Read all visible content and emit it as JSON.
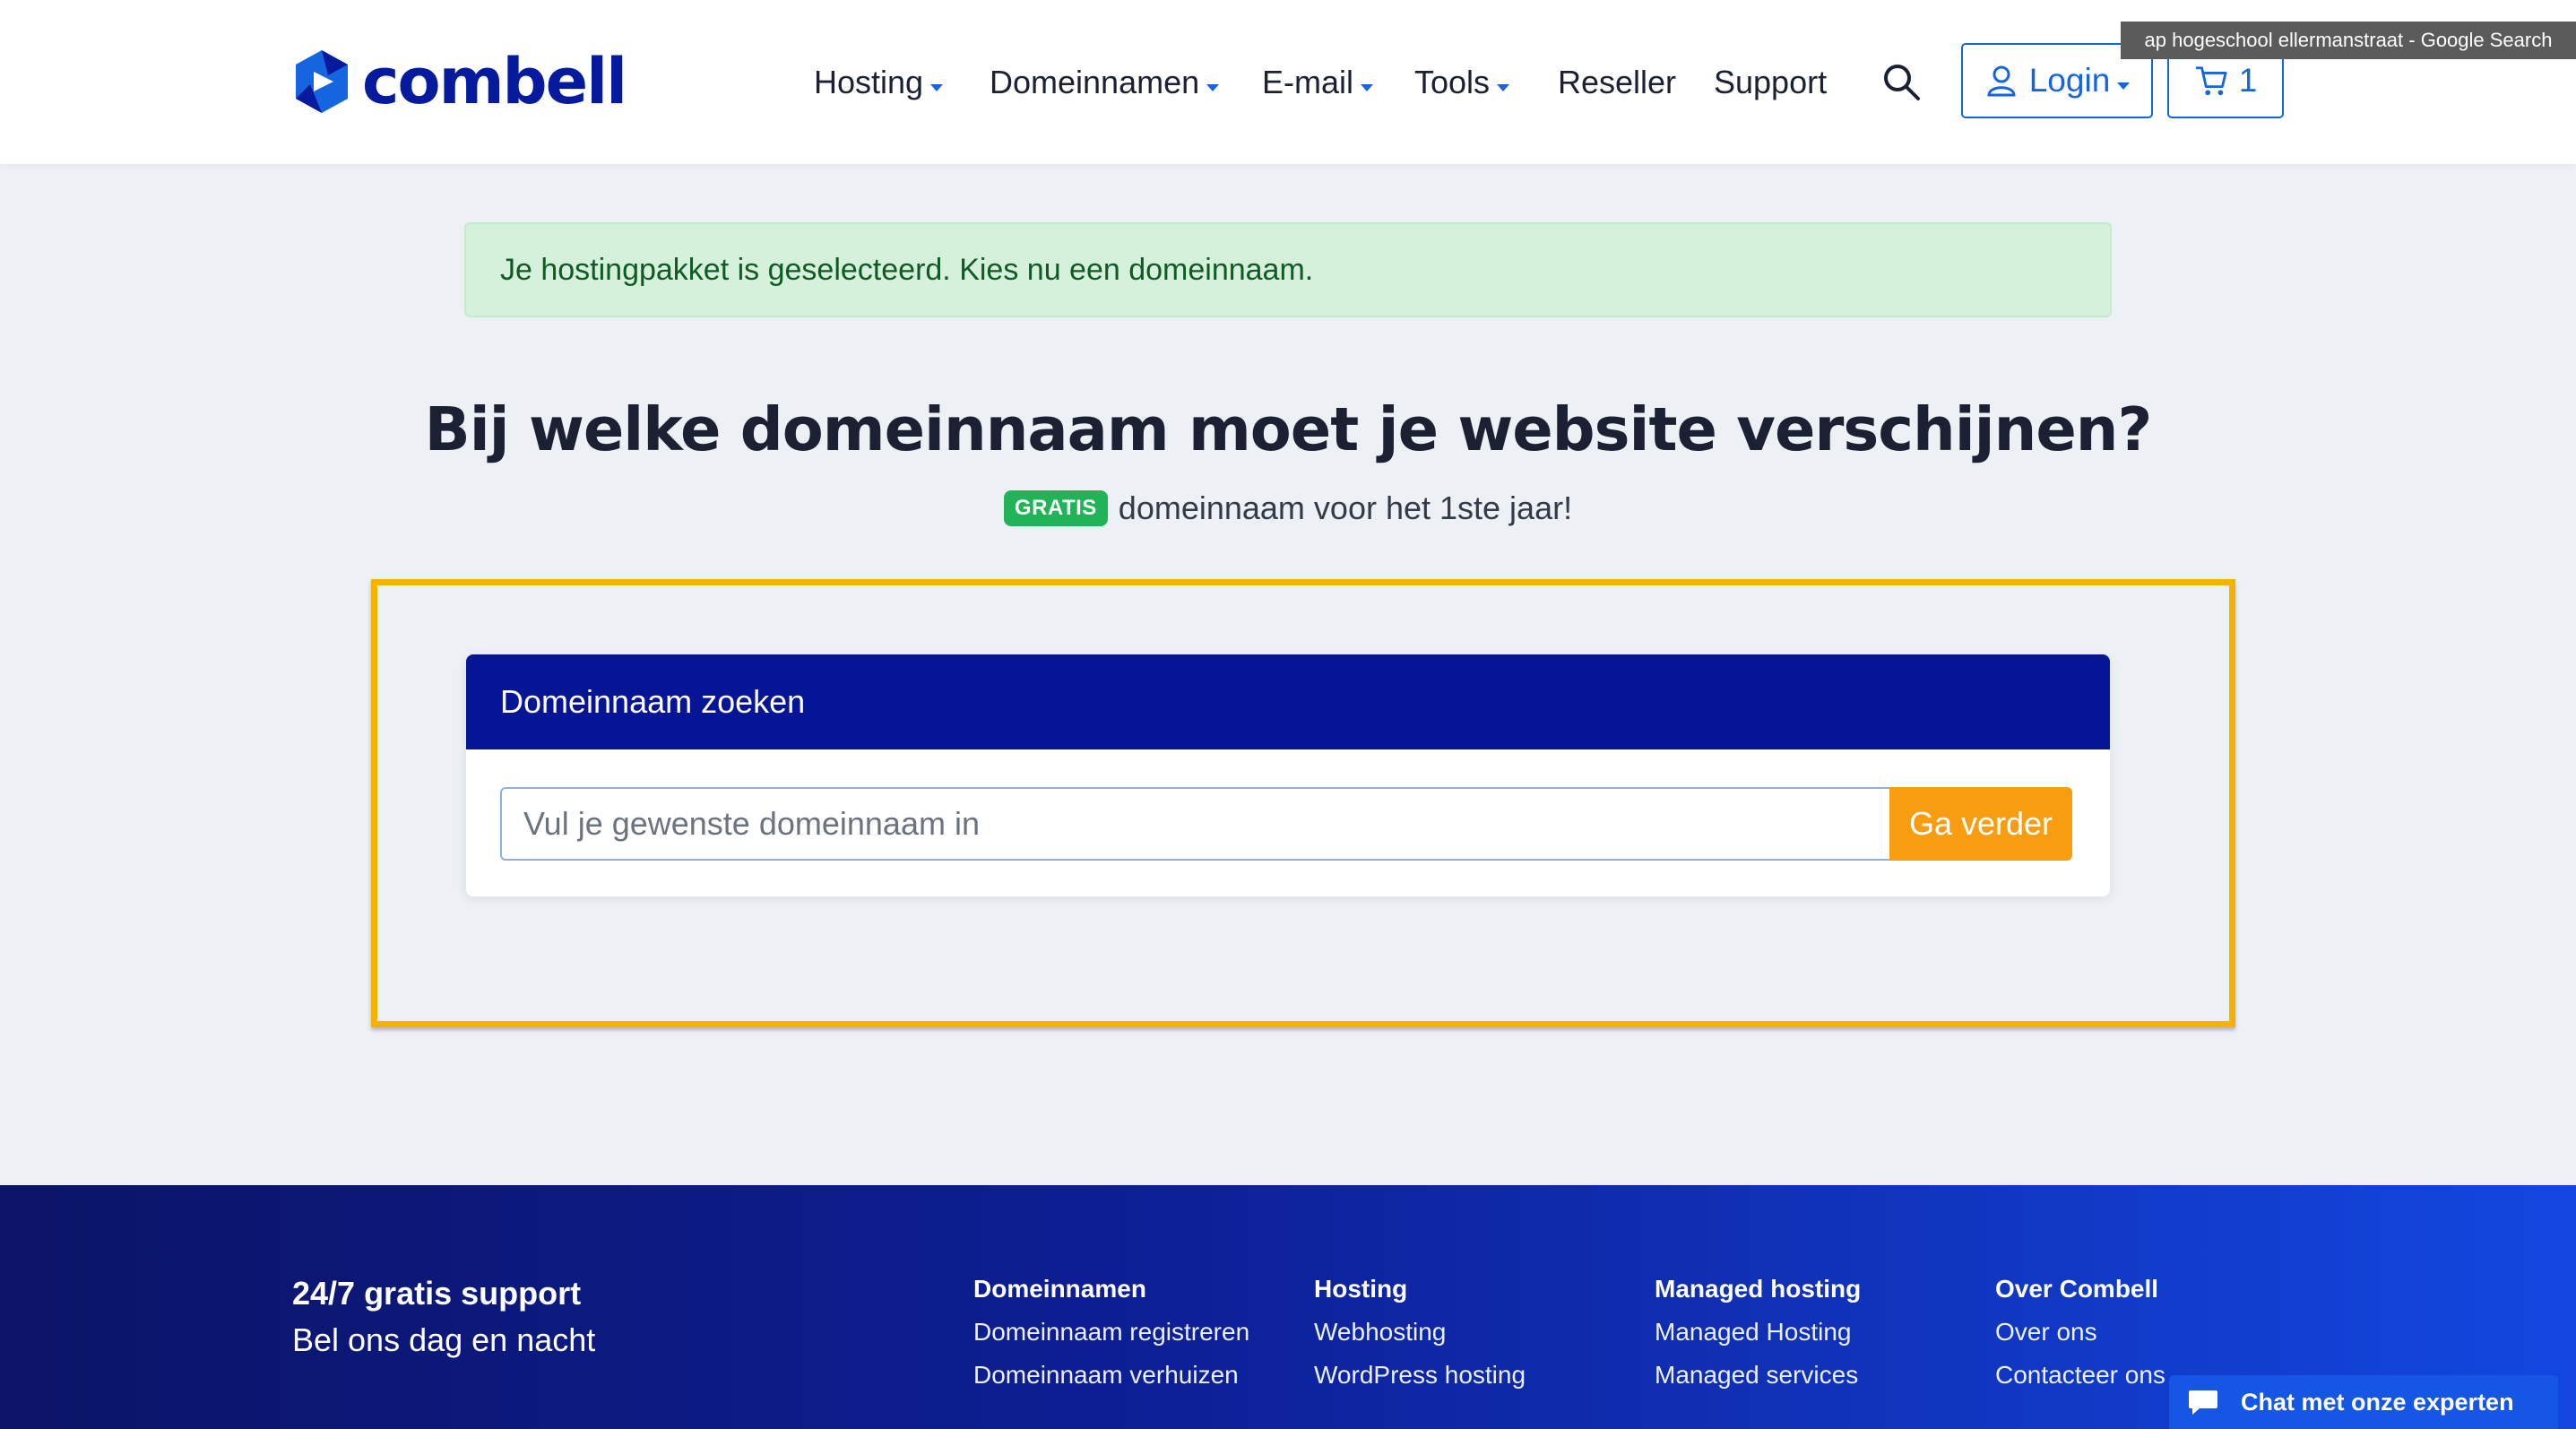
{
  "header": {
    "brand": "combell",
    "nav": [
      {
        "label": "Hosting",
        "dropdown": true
      },
      {
        "label": "Domeinnamen",
        "dropdown": true
      },
      {
        "label": "E-mail",
        "dropdown": true
      },
      {
        "label": "Tools",
        "dropdown": true
      },
      {
        "label": "Reseller",
        "dropdown": false
      },
      {
        "label": "Support",
        "dropdown": false
      }
    ],
    "login_label": "Login",
    "cart_count": "1",
    "tooltip": "ap hogeschool ellermanstraat - Google Search"
  },
  "alert": {
    "text": "Je hostingpakket is geselecteerd. Kies nu een domeinnaam."
  },
  "hero": {
    "title": "Bij welke domeinnaam moet je website verschijnen?",
    "badge": "GRATIS",
    "subtitle": "domeinnaam voor het 1ste jaar!"
  },
  "search": {
    "heading": "Domeinnaam zoeken",
    "placeholder": "Vul je gewenste domeinnaam in",
    "button": "Ga verder"
  },
  "footer": {
    "support_title": "24/7 gratis support",
    "support_sub": "Bel ons dag en nacht",
    "columns": [
      {
        "title": "Domeinnamen",
        "links": [
          "Domeinnaam registreren",
          "Domeinnaam verhuizen"
        ]
      },
      {
        "title": "Hosting",
        "links": [
          "Webhosting",
          "WordPress hosting"
        ]
      },
      {
        "title": "Managed hosting",
        "links": [
          "Managed Hosting",
          "Managed services"
        ]
      },
      {
        "title": "Over Combell",
        "links": [
          "Over ons",
          "Contacteer ons"
        ]
      }
    ],
    "chat": "Chat met onze experten"
  },
  "colors": {
    "brand": "#061a9e",
    "link": "#1565e0",
    "cta": "#f99d10",
    "highlight": "#f5b300",
    "success_bg": "#d5f0db",
    "badge": "#21b357"
  },
  "icons": [
    "logo-icon",
    "search-icon",
    "user-icon",
    "cart-icon",
    "chat-icon",
    "chevron-down-icon"
  ]
}
